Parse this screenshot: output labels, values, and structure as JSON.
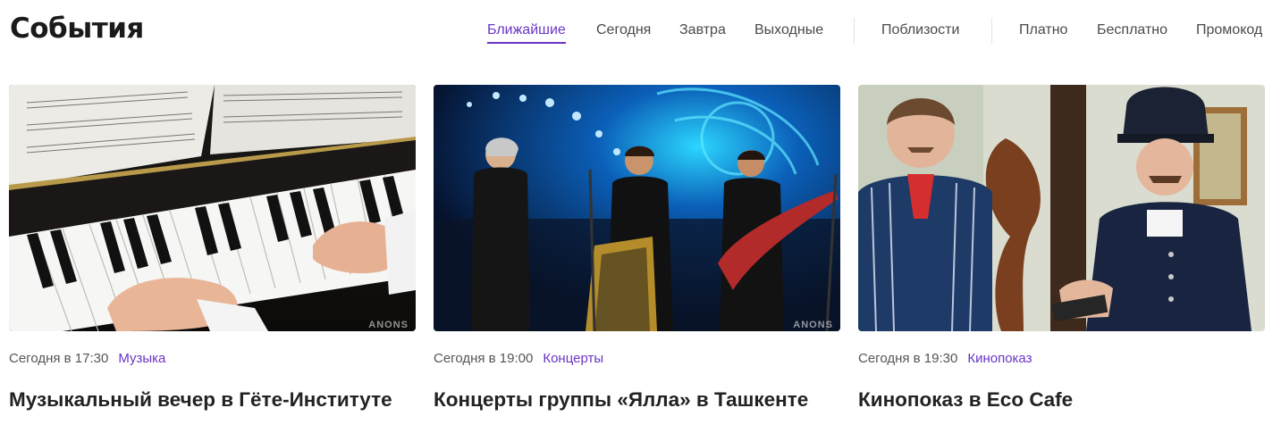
{
  "page": {
    "title": "События"
  },
  "nav": {
    "items": [
      {
        "label": "Ближайшие",
        "active": true
      },
      {
        "label": "Сегодня"
      },
      {
        "label": "Завтра"
      },
      {
        "label": "Выходные"
      },
      {
        "label": "Поблизости"
      },
      {
        "label": "Платно"
      },
      {
        "label": "Бесплатно"
      },
      {
        "label": "Промокод"
      }
    ]
  },
  "events": [
    {
      "time": "Сегодня в 17:30",
      "category": "Музыка",
      "title": "Музыкальный вечер в Гёте-Институте",
      "watermark": "ANONS"
    },
    {
      "time": "Сегодня в 19:00",
      "category": "Концерты",
      "title": "Концерты группы «Ялла» в Ташкенте",
      "watermark": "ANONS"
    },
    {
      "time": "Сегодня в 19:30",
      "category": "Кинопоказ",
      "title": "Кинопоказ в Eco Cafe"
    }
  ],
  "colors": {
    "accent": "#6a35c4",
    "text": "#222222",
    "muted": "#555555"
  }
}
